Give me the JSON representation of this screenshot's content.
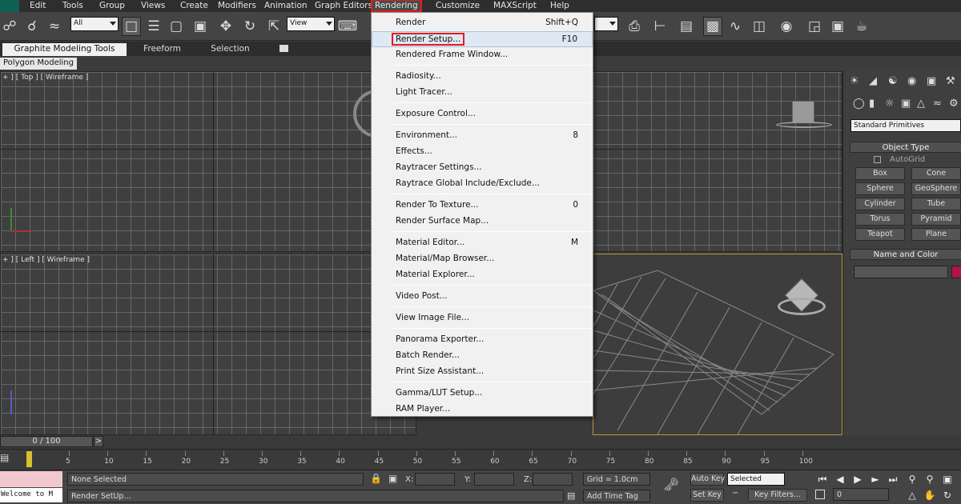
{
  "menubar": {
    "items": [
      "Edit",
      "Tools",
      "Group",
      "Views",
      "Create",
      "Modifiers",
      "Animation",
      "Graph Editors",
      "Rendering",
      "Customize",
      "MAXScript",
      "Help"
    ],
    "active_index": 8
  },
  "toolbar": {
    "selection_filter": "All",
    "reference_coord": "View"
  },
  "ribbon": {
    "tabs": [
      "Graphite Modeling Tools",
      "Freeform",
      "Selection"
    ],
    "active_tab": "Graphite Modeling Tools",
    "sub_label": "Polygon Modeling"
  },
  "viewports": {
    "top_label": "+ ] [ Top ] [ Wireframe ]",
    "left_label": "+ ] [ Left ] [ Wireframe ]"
  },
  "rendering_menu": {
    "groups": [
      [
        {
          "label": "Render",
          "shortcut": "Shift+Q"
        },
        {
          "label": "Render Setup...",
          "shortcut": "F10",
          "highlighted": true
        },
        {
          "label": "Rendered Frame Window...",
          "shortcut": ""
        }
      ],
      [
        {
          "label": "Radiosity...",
          "shortcut": ""
        },
        {
          "label": "Light Tracer...",
          "shortcut": ""
        }
      ],
      [
        {
          "label": "Exposure Control...",
          "shortcut": ""
        }
      ],
      [
        {
          "label": "Environment...",
          "shortcut": "8"
        },
        {
          "label": "Effects...",
          "shortcut": ""
        },
        {
          "label": "Raytracer Settings...",
          "shortcut": ""
        },
        {
          "label": "Raytrace Global Include/Exclude...",
          "shortcut": ""
        }
      ],
      [
        {
          "label": "Render To Texture...",
          "shortcut": "0"
        },
        {
          "label": "Render Surface Map...",
          "shortcut": ""
        }
      ],
      [
        {
          "label": "Material Editor...",
          "shortcut": "M"
        },
        {
          "label": "Material/Map Browser...",
          "shortcut": ""
        },
        {
          "label": "Material Explorer...",
          "shortcut": ""
        }
      ],
      [
        {
          "label": "Video Post...",
          "shortcut": ""
        }
      ],
      [
        {
          "label": "View Image File...",
          "shortcut": ""
        }
      ],
      [
        {
          "label": "Panorama Exporter...",
          "shortcut": ""
        },
        {
          "label": "Batch Render...",
          "shortcut": ""
        },
        {
          "label": "Print Size Assistant...",
          "shortcut": ""
        }
      ],
      [
        {
          "label": "Gamma/LUT Setup...",
          "shortcut": ""
        },
        {
          "label": "RAM Player...",
          "shortcut": ""
        }
      ]
    ]
  },
  "command_panel": {
    "category": "Standard Primitives",
    "object_type_header": "Object Type",
    "autogrid_label": "AutoGrid",
    "buttons": [
      "Box",
      "Cone",
      "Sphere",
      "GeoSphere",
      "Cylinder",
      "Tube",
      "Torus",
      "Pyramid",
      "Teapot",
      "Plane"
    ],
    "name_color_header": "Name and Color",
    "object_color": "#b0154a"
  },
  "timeline": {
    "frame_display": "0 / 100",
    "next_label": ">",
    "ticks": [
      "5",
      "10",
      "15",
      "20",
      "25",
      "30",
      "35",
      "40",
      "45",
      "50",
      "55",
      "60",
      "65",
      "70",
      "75",
      "80",
      "85",
      "90",
      "95",
      "100"
    ]
  },
  "status": {
    "listener_text": "Welcome to M",
    "selection_text": "None Selected",
    "prompt_text": "Render SetUp...",
    "x_label": "X:",
    "y_label": "Y:",
    "z_label": "Z:",
    "grid_text": "Grid = 1.0cm",
    "add_time_tag": "Add Time Tag",
    "auto_key": "Auto Key",
    "set_key": "Set Key",
    "key_mode": "Selected",
    "key_filters": "Key Filters...",
    "current_frame": "0"
  }
}
